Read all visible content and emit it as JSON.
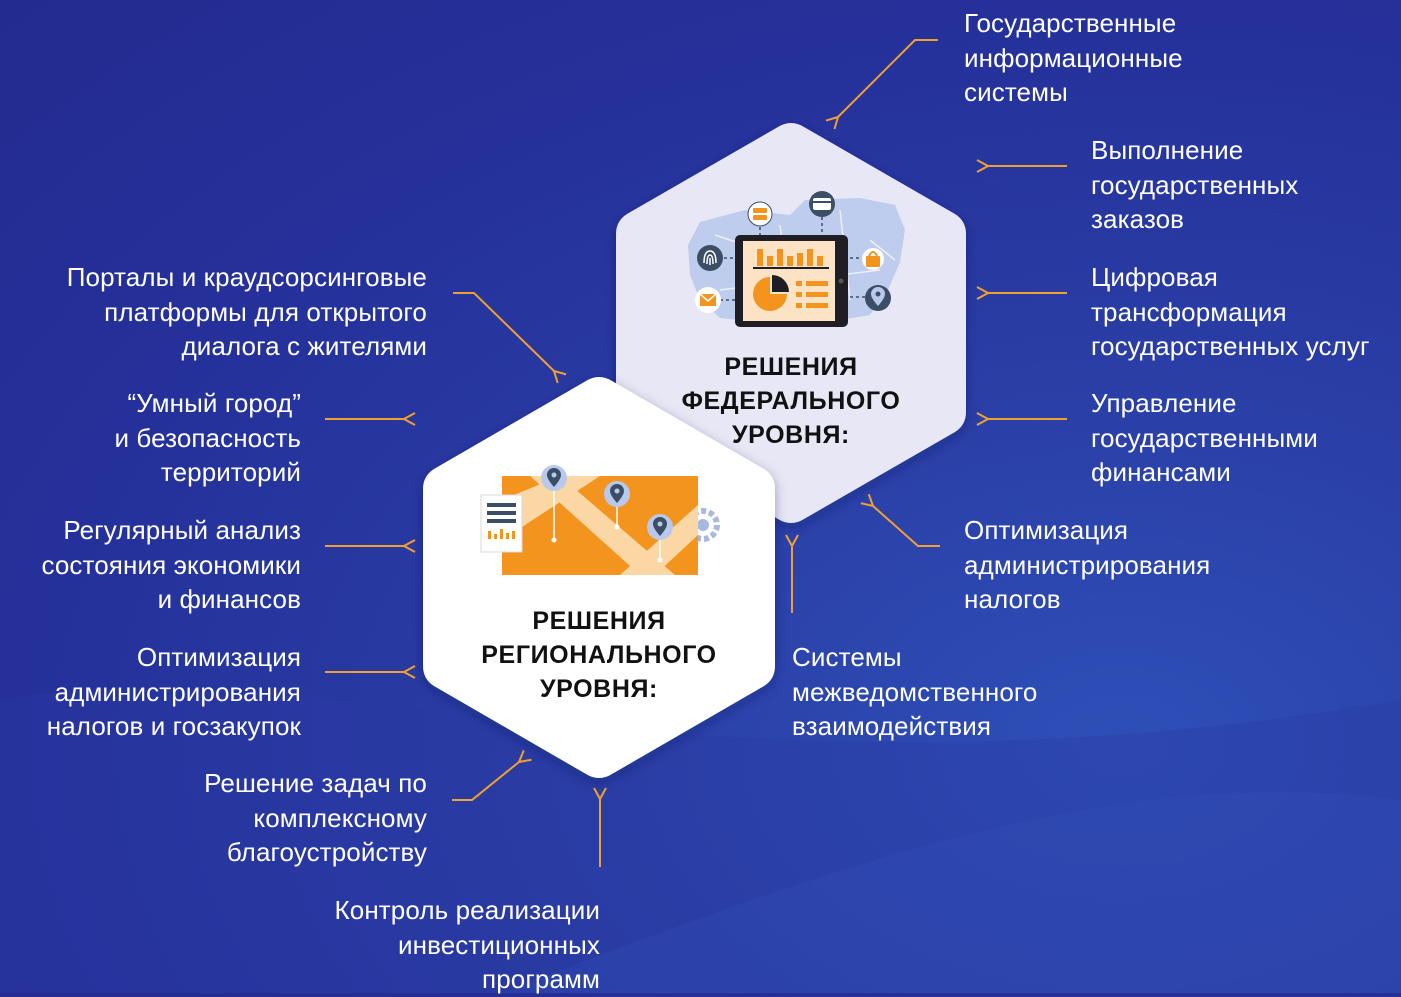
{
  "federal": {
    "title": "РЕШЕНИЯ\nФЕДЕРАЛЬНОГО\nУРОВНЯ:"
  },
  "regional": {
    "title": "РЕШЕНИЯ\nРЕГИОНАЛЬНОГО\nУРОВНЯ:"
  },
  "labels": {
    "gis": "Государственные\nинформационные\nсистемы",
    "orders": "Выполнение\nгосударственных\nзаказов",
    "digital": "Цифровая\nтрансформация\nгосударственных услуг",
    "finance": "Управление\nгосударственными\nфинансами",
    "tax_fed": "Оптимизация\nадминистрирования\nналогов",
    "interagency": "Системы\nмежведомственного\nвзаимодействия",
    "portals": "Порталы и краудсорсинговые\nплатформы для открытого\nдиалога с жителями",
    "smart_city": "“Умный город”\nи безопасность\nтерриторий",
    "economy": "Регулярный анализ\nсостояния экономики\nи финансов",
    "tax_reg": "Оптимизация\nадминистрирования\nналогов и госзакупок",
    "improvement": "Решение задач по\nкомплексному\nблагоустройству",
    "investment": "Контроль реализации\nинвестиционных\nпрограмм"
  },
  "colors": {
    "arrow": "#f0a030",
    "federal_hex": "#e8e7f5",
    "regional_hex": "#ffffff",
    "accent_orange": "#f3941e",
    "icon_dark": "#3b4e66"
  }
}
